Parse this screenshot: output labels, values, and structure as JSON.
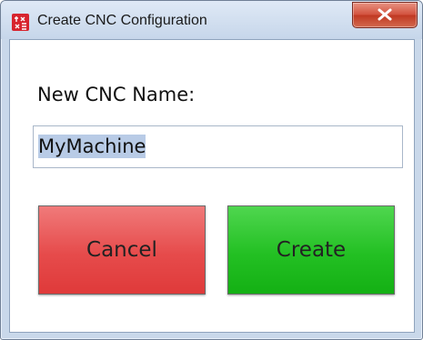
{
  "window": {
    "title": "Create CNC Configuration",
    "app_icon": "app-logo-icon",
    "close_icon": "close-icon"
  },
  "form": {
    "name_label": "New CNC Name:",
    "name_value": "MyMachine",
    "name_value_selected": true
  },
  "buttons": {
    "cancel_label": "Cancel",
    "create_label": "Create"
  },
  "colors": {
    "cancel_button": "#e64b4b",
    "create_button": "#23c023",
    "close_button": "#c9432e",
    "selection": "#b8cbe6"
  }
}
